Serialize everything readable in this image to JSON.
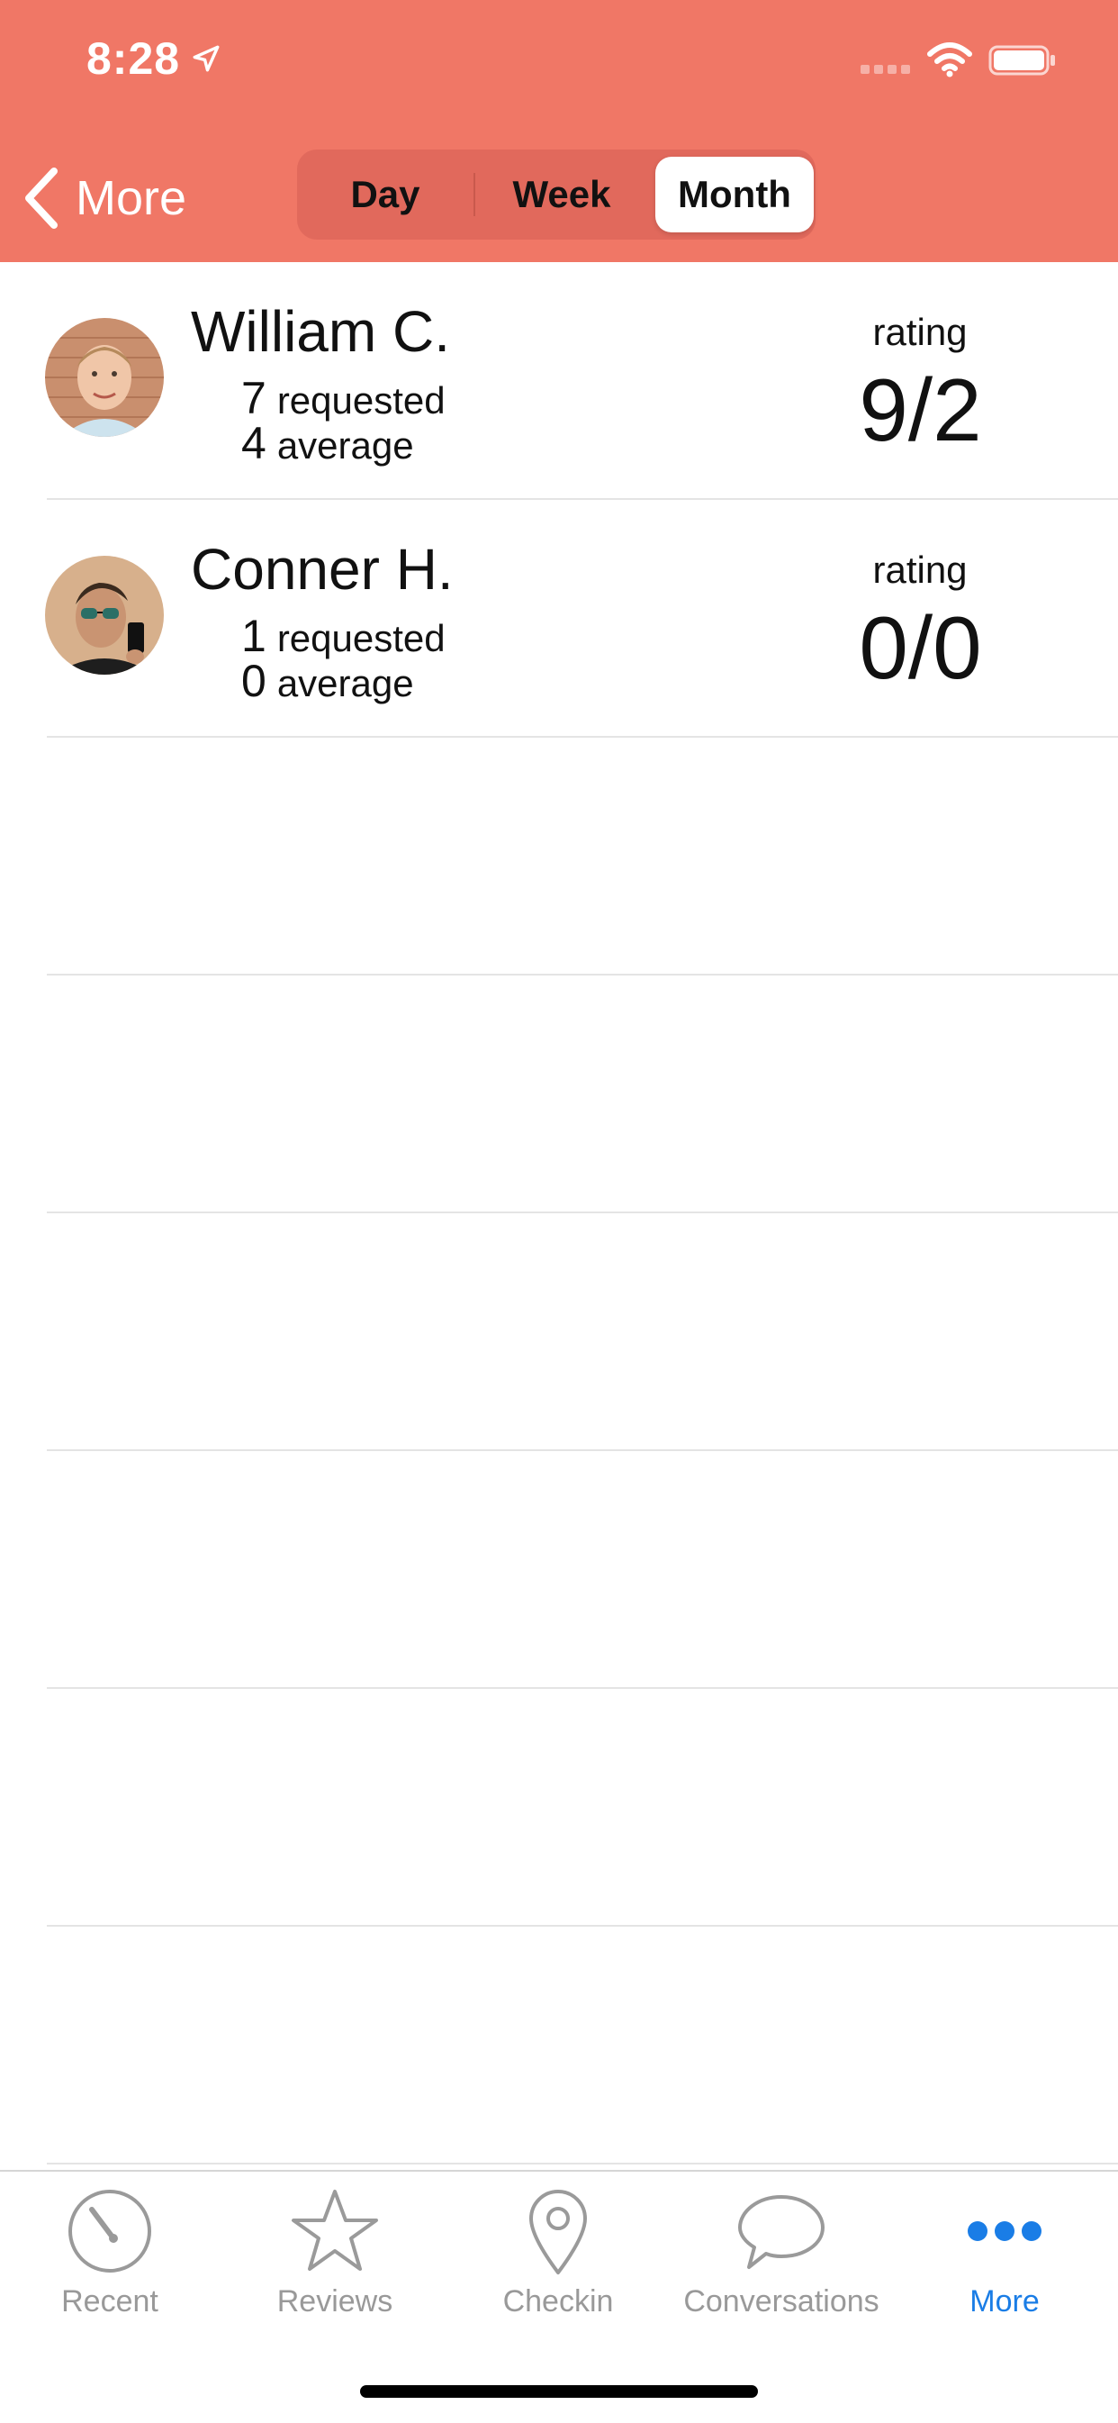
{
  "status_bar": {
    "time": "8:28",
    "icons": [
      "location-arrow-icon",
      "cellular-signal-icon",
      "wifi-icon",
      "battery-icon"
    ]
  },
  "nav": {
    "back_label": "More",
    "segments": [
      "Day",
      "Week",
      "Month"
    ],
    "selected_segment": "Month"
  },
  "colors": {
    "header": "#f07766",
    "segment_bg": "#e1695c",
    "active_tab": "#1a7de6",
    "inactive_tab": "#999999"
  },
  "employees": [
    {
      "name": "William C.",
      "requested_count": "7",
      "requested_label": "requested",
      "average_count": "4",
      "average_label": "average",
      "rating_label": "rating",
      "rating_value": "9/2"
    },
    {
      "name": "Conner H.",
      "requested_count": "1",
      "requested_label": "requested",
      "average_count": "0",
      "average_label": "average",
      "rating_label": "rating",
      "rating_value": "0/0"
    }
  ],
  "tabbar": {
    "items": [
      {
        "label": "Recent",
        "icon": "gauge-icon"
      },
      {
        "label": "Reviews",
        "icon": "star-icon"
      },
      {
        "label": "Checkin",
        "icon": "map-pin-icon"
      },
      {
        "label": "Conversations",
        "icon": "speech-bubble-icon"
      },
      {
        "label": "More",
        "icon": "more-dots-icon"
      }
    ],
    "active": "More"
  }
}
